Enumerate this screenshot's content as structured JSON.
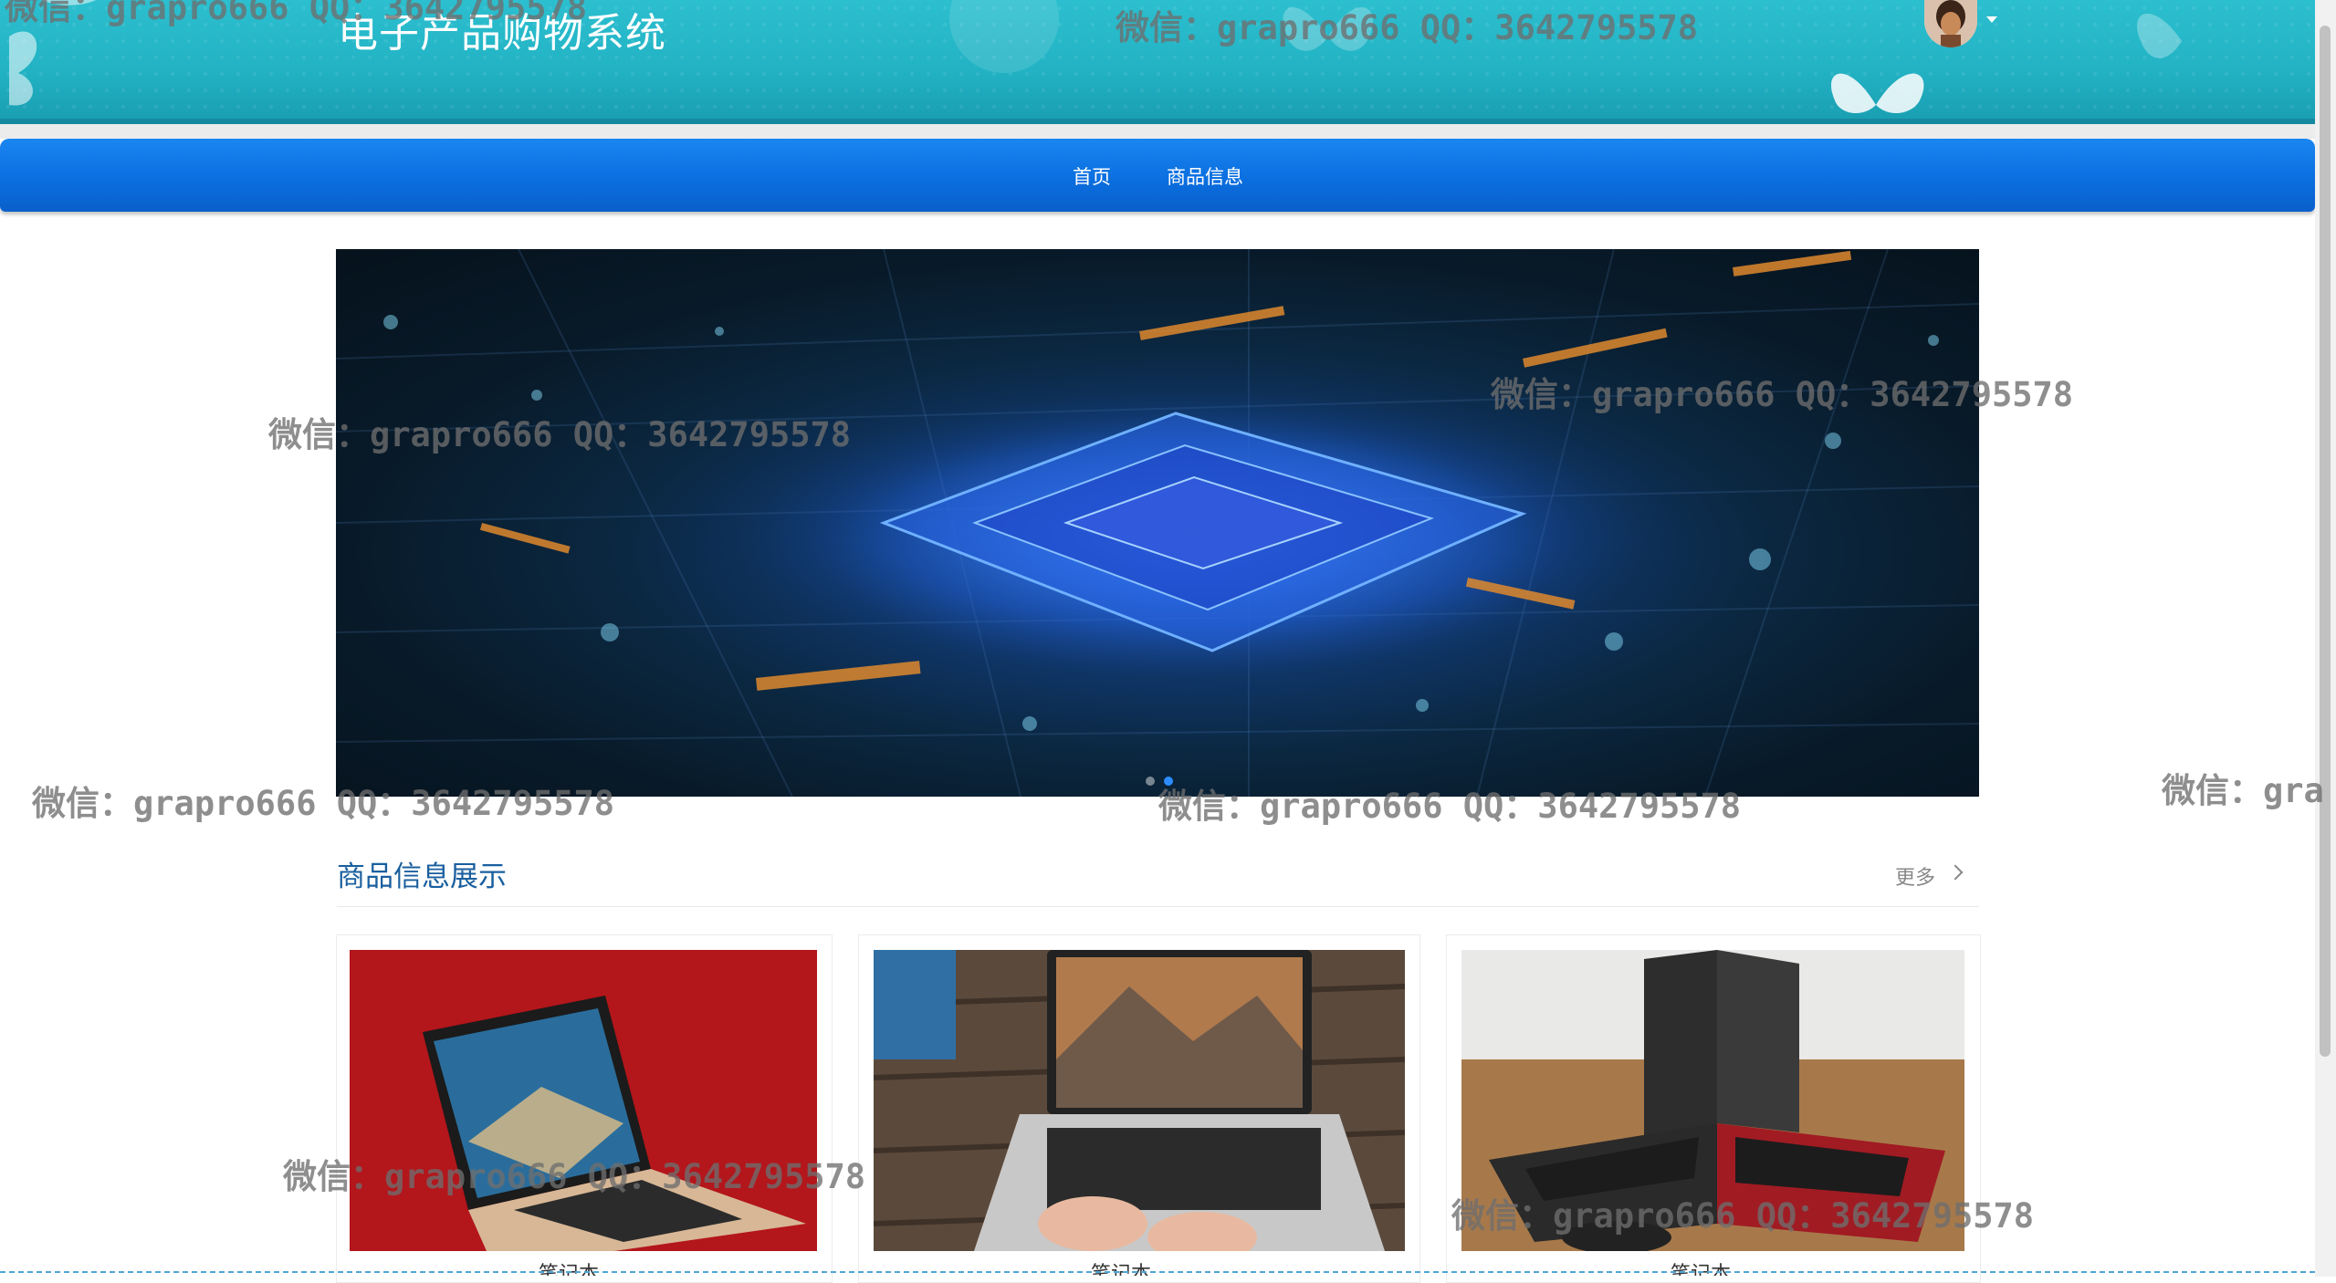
{
  "header": {
    "title": "电子产品购物系统",
    "avatar_label": "用户头像"
  },
  "nav": {
    "items": [
      {
        "label": "首页"
      },
      {
        "label": "商品信息"
      }
    ]
  },
  "banner": {
    "slide_count": 2,
    "active_index": 1
  },
  "section": {
    "title": "商品信息展示",
    "more_label": "更多"
  },
  "products": [
    {
      "name": "笔记本"
    },
    {
      "name": "笔记本"
    },
    {
      "name": "笔记本"
    }
  ],
  "watermark": {
    "text": "微信：grapro666 QQ：3642795578",
    "partial_text": "微信：gra"
  },
  "colors": {
    "header_bg": "#22b2c4",
    "nav_bg": "#0b6fe0",
    "section_title": "#1a5f9e",
    "text_light": "#ffffff"
  }
}
